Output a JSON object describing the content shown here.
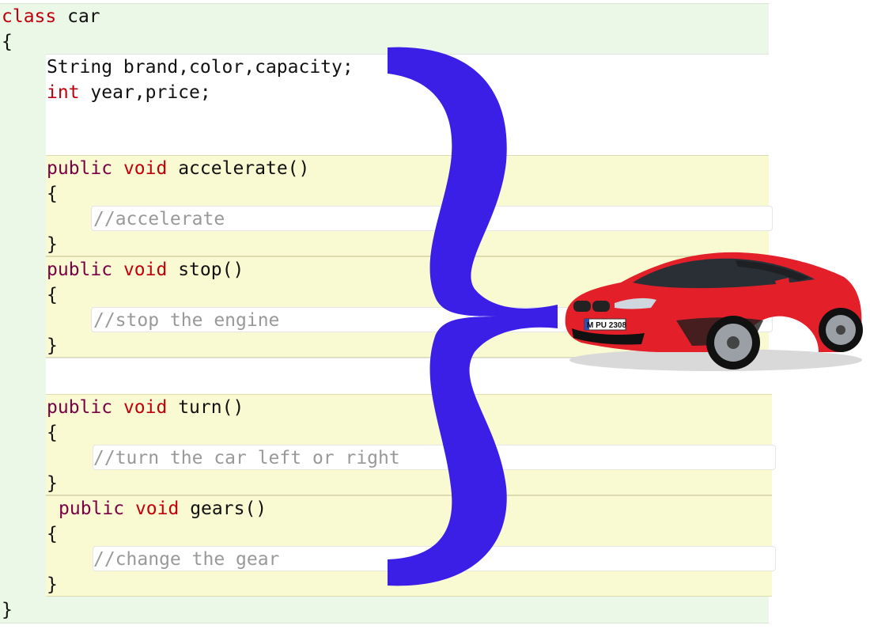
{
  "code": {
    "class_kw": "class",
    "class_name": "car",
    "open_brace": "{",
    "close_brace": "}",
    "fields": [
      {
        "text": "String brand,color,capacity;"
      },
      {
        "kw": "int",
        "text": "year,price;"
      }
    ],
    "methods": [
      {
        "modifier": "public",
        "type": "void",
        "name": "accelerate()",
        "open": "{",
        "comment": "//accelerate",
        "close": "}"
      },
      {
        "modifier": "public",
        "type": "void",
        "name": "stop()",
        "open": "{",
        "comment": "//stop the engine",
        "close": "}"
      },
      {
        "modifier": "public",
        "type": "void",
        "name": "turn()",
        "open": "{",
        "comment": "//turn the car left or right",
        "close": "}"
      },
      {
        "modifier": "public",
        "type": "void",
        "name": "gears()",
        "open": "{",
        "comment": "//change the gear",
        "close": "}"
      }
    ]
  },
  "colors": {
    "brace": "#3b1fe6",
    "car_body": "#e3202a"
  },
  "icons": {
    "brace": "curly-brace-icon",
    "car": "car-image"
  },
  "car": {
    "plate": "M PU 2308"
  }
}
